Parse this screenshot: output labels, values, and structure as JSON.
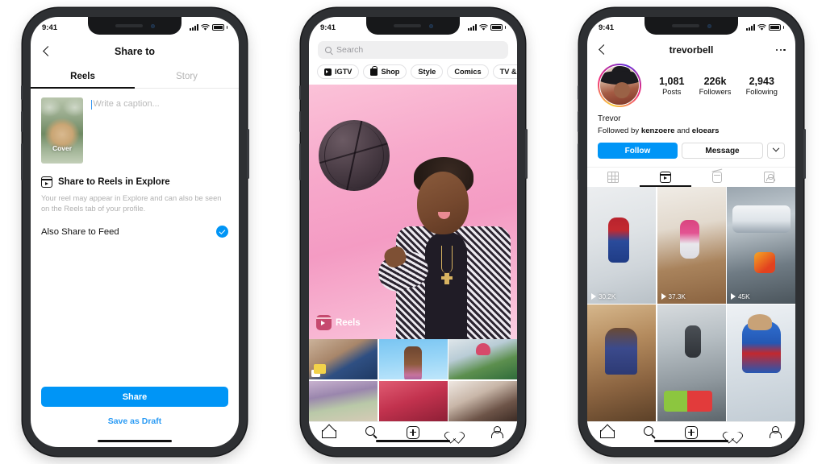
{
  "meta": {
    "background": "#ffffff",
    "accent_blue": "#0095f6",
    "link_blue": "#2b9bf4"
  },
  "phone1": {
    "status": {
      "time": "9:41",
      "signal_icon": "cellular-bars-icon",
      "wifi_icon": "wifi-icon",
      "battery_icon": "battery-full-icon"
    },
    "nav": {
      "back_icon": "back-chevron-icon",
      "title": "Share to"
    },
    "tabs": [
      {
        "label": "Reels",
        "active": true
      },
      {
        "label": "Story",
        "active": false
      }
    ],
    "composer": {
      "cover_label": "Cover",
      "caption_placeholder": "Write a caption...",
      "caption_value": ""
    },
    "explore_section": {
      "icon": "reels-icon",
      "title": "Share to Reels in Explore",
      "description": "Your reel may appear in Explore and can also be seen on the Reels tab of your profile.",
      "toggle_label": "Also Share to Feed",
      "toggle_checked": true,
      "check_color": "#0095f6"
    },
    "actions": {
      "share_label": "Share",
      "draft_label": "Save as Draft"
    }
  },
  "phone2": {
    "status": {
      "time": "9:41",
      "signal_icon": "cellular-bars-icon",
      "wifi_icon": "wifi-icon",
      "battery_icon": "battery-full-icon"
    },
    "search": {
      "placeholder": "Search",
      "icon": "search-icon"
    },
    "categories": [
      {
        "label": "IGTV",
        "icon": "igtv-icon"
      },
      {
        "label": "Shop",
        "icon": "shop-bag-icon"
      },
      {
        "label": "Style",
        "icon": ""
      },
      {
        "label": "Comics",
        "icon": ""
      },
      {
        "label": "TV & Movies",
        "icon": ""
      }
    ],
    "hero": {
      "badge_label": "Reels",
      "badge_icon": "reels-icon"
    },
    "tabbar": [
      {
        "name": "home",
        "icon": "home-icon"
      },
      {
        "name": "search",
        "icon": "search-icon"
      },
      {
        "name": "create",
        "icon": "plus-square-icon"
      },
      {
        "name": "activity",
        "icon": "heart-icon"
      },
      {
        "name": "profile",
        "icon": "person-icon"
      }
    ]
  },
  "phone3": {
    "status": {
      "time": "9:41",
      "signal_icon": "cellular-bars-icon",
      "wifi_icon": "wifi-icon",
      "battery_icon": "battery-full-icon"
    },
    "nav": {
      "back_icon": "back-chevron-icon",
      "username": "trevorbell",
      "more_icon": "more-dots-icon"
    },
    "stats": [
      {
        "value": "1,081",
        "label": "Posts"
      },
      {
        "value": "226k",
        "label": "Followers"
      },
      {
        "value": "2,943",
        "label": "Following"
      }
    ],
    "bio": {
      "display_name": "Trevor",
      "followed_by_prefix": "Followed by ",
      "followed_by_first": "kenzoere",
      "followed_by_join": " and ",
      "followed_by_second": "eloears"
    },
    "actions": {
      "follow_label": "Follow",
      "message_label": "Message",
      "caret_icon": "chevron-down-icon"
    },
    "profile_tabs": [
      {
        "name": "grid",
        "icon": "grid-icon",
        "active": false
      },
      {
        "name": "reels",
        "icon": "reels-icon",
        "active": true
      },
      {
        "name": "igtv",
        "icon": "igtv-icon",
        "active": false
      },
      {
        "name": "tagged",
        "icon": "tagged-person-icon",
        "active": false
      }
    ],
    "reels": [
      {
        "views": "30.2K",
        "play_icon": "play-icon"
      },
      {
        "views": "37.3K",
        "play_icon": "play-icon"
      },
      {
        "views": "45K",
        "play_icon": "play-icon"
      },
      {
        "views": "",
        "play_icon": ""
      },
      {
        "views": "",
        "play_icon": ""
      },
      {
        "views": "",
        "play_icon": ""
      }
    ],
    "tabbar": [
      {
        "name": "home",
        "icon": "home-icon"
      },
      {
        "name": "search",
        "icon": "search-icon"
      },
      {
        "name": "create",
        "icon": "plus-square-icon"
      },
      {
        "name": "activity",
        "icon": "heart-icon"
      },
      {
        "name": "profile",
        "icon": "person-icon"
      }
    ]
  }
}
